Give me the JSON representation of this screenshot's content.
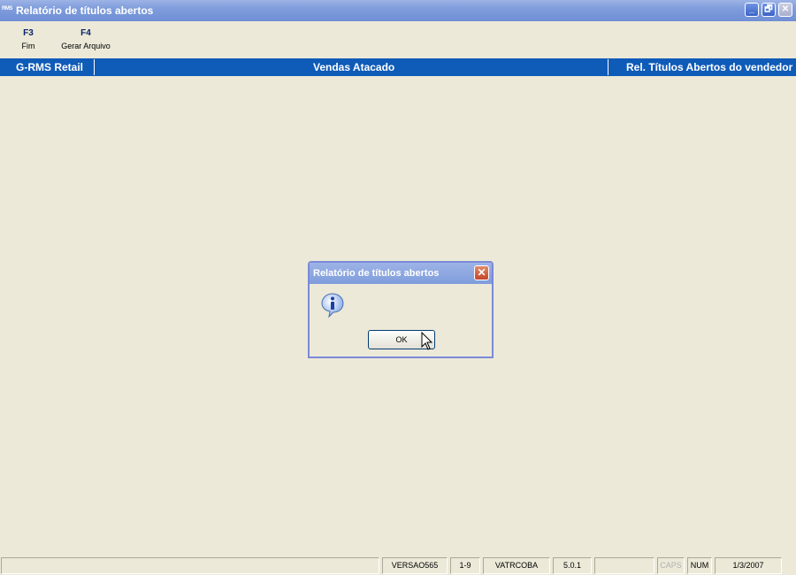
{
  "window": {
    "app_icon_text": "RMS",
    "title": "Relatório de títulos abertos",
    "minimize_glyph": "_",
    "restore_glyph": "🗗",
    "close_glyph": "✕"
  },
  "toolbar": {
    "keys": [
      {
        "key": "F3",
        "label": "Fim"
      },
      {
        "key": "F4",
        "label": "Gerar Arquivo"
      }
    ]
  },
  "header": {
    "left": "G-RMS Retail",
    "center": "Vendas Atacado",
    "right": "Rel. Títulos Abertos do vendedor"
  },
  "dialog": {
    "title": "Relatório de títulos abertos",
    "close_glyph": "✕",
    "icon": "info-icon",
    "ok_label": "OK"
  },
  "statusbar": {
    "cells": [
      "",
      "VERSAO565",
      "1-9",
      "VATRCOBA",
      "5.0.1",
      "",
      "CAPS",
      "NUM",
      "1/3/2007"
    ]
  },
  "colors": {
    "header_bg": "#0e5bb8",
    "window_bg": "#ece9d8",
    "fkey_color": "#0a246a"
  }
}
